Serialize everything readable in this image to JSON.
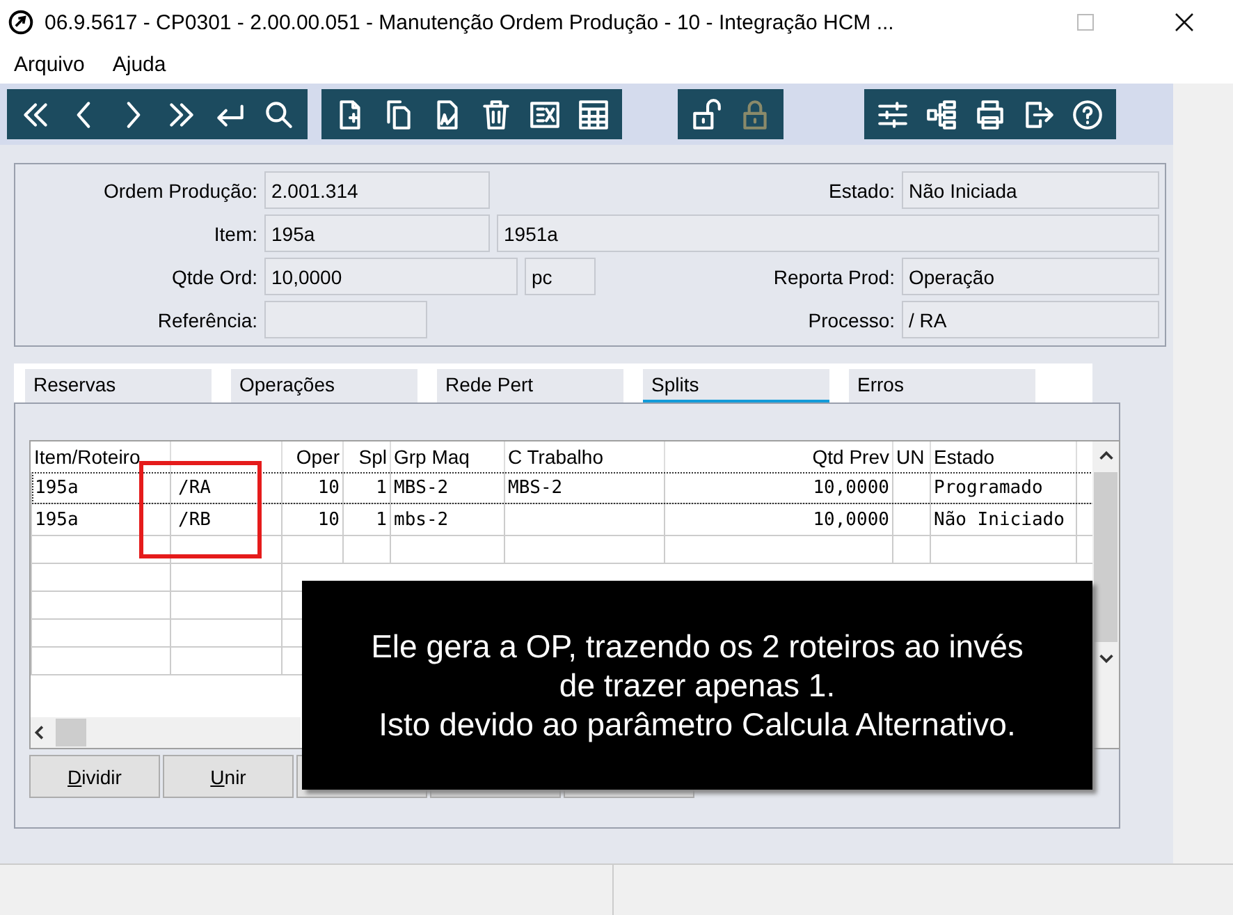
{
  "window": {
    "title": "06.9.5617 - CP0301 - 2.00.00.051 - Manutenção Ordem Produção - 10 - Integração HCM ..."
  },
  "menu": [
    {
      "label": "Arquivo"
    },
    {
      "label": "Ajuda"
    }
  ],
  "toolbar": [
    [
      {
        "kind": "first",
        "disabled": false
      },
      {
        "kind": "prev",
        "disabled": false
      },
      {
        "kind": "next",
        "disabled": false
      },
      {
        "kind": "last",
        "disabled": false
      },
      {
        "kind": "goto",
        "disabled": false
      },
      {
        "kind": "search",
        "disabled": false
      }
    ],
    [
      {
        "kind": "new",
        "disabled": false
      },
      {
        "kind": "copy",
        "disabled": false
      },
      {
        "kind": "edit",
        "disabled": false
      },
      {
        "kind": "delete",
        "disabled": false
      },
      {
        "kind": "excel",
        "disabled": false
      },
      {
        "kind": "calc",
        "disabled": false
      }
    ],
    [
      {
        "kind": "unlock",
        "disabled": false
      },
      {
        "kind": "lock",
        "disabled": true
      }
    ],
    [
      {
        "kind": "sliders",
        "disabled": false
      },
      {
        "kind": "tree",
        "disabled": false
      },
      {
        "kind": "print",
        "disabled": false
      },
      {
        "kind": "exit",
        "disabled": false
      },
      {
        "kind": "help",
        "disabled": false
      }
    ]
  ],
  "form": {
    "ordem": {
      "label": "Ordem Produção:",
      "value": "2.001.314"
    },
    "estado": {
      "label": "Estado:",
      "value": "Não Iniciada"
    },
    "item": {
      "label": "Item:",
      "value": "195a",
      "description": "1951a"
    },
    "qtde": {
      "label": "Qtde Ord:",
      "value": "10,0000",
      "unit": "pc"
    },
    "reporta": {
      "label": "Reporta Prod:",
      "value": "Operação"
    },
    "referencia": {
      "label": "Referência:"
    },
    "processo": {
      "label": "Processo:",
      "value": "/ RA"
    }
  },
  "tabs": [
    {
      "label": "Reservas",
      "selected": false
    },
    {
      "label": "Operações",
      "selected": false
    },
    {
      "label": "Rede Pert",
      "selected": false
    },
    {
      "label": "Splits",
      "selected": true
    },
    {
      "label": "Erros",
      "selected": false
    }
  ],
  "table": {
    "columns": [
      "Item/Roteiro",
      "",
      "Oper",
      "Spl",
      "Grp Maq",
      "C Trabalho",
      "Qtd Prev",
      "UN",
      "Estado"
    ],
    "rows": [
      {
        "selected": true,
        "cells": [
          "195a",
          "/RA",
          "10",
          "1",
          "MBS-2",
          "MBS-2",
          "10,0000",
          "",
          "Programado"
        ]
      },
      {
        "selected": false,
        "cells": [
          "195a",
          "/RB",
          "10",
          "1",
          "mbs-2",
          "",
          "10,0000",
          "",
          "Não Iniciado"
        ]
      }
    ]
  },
  "buttons": [
    {
      "label": "Dividir"
    },
    {
      "label": "Unir"
    }
  ],
  "callout": [
    "Ele gera a OP, trazendo os 2 roteiros ao invés",
    "de trazer apenas 1.",
    "Isto devido ao parâmetro Calcula Alternativo."
  ]
}
